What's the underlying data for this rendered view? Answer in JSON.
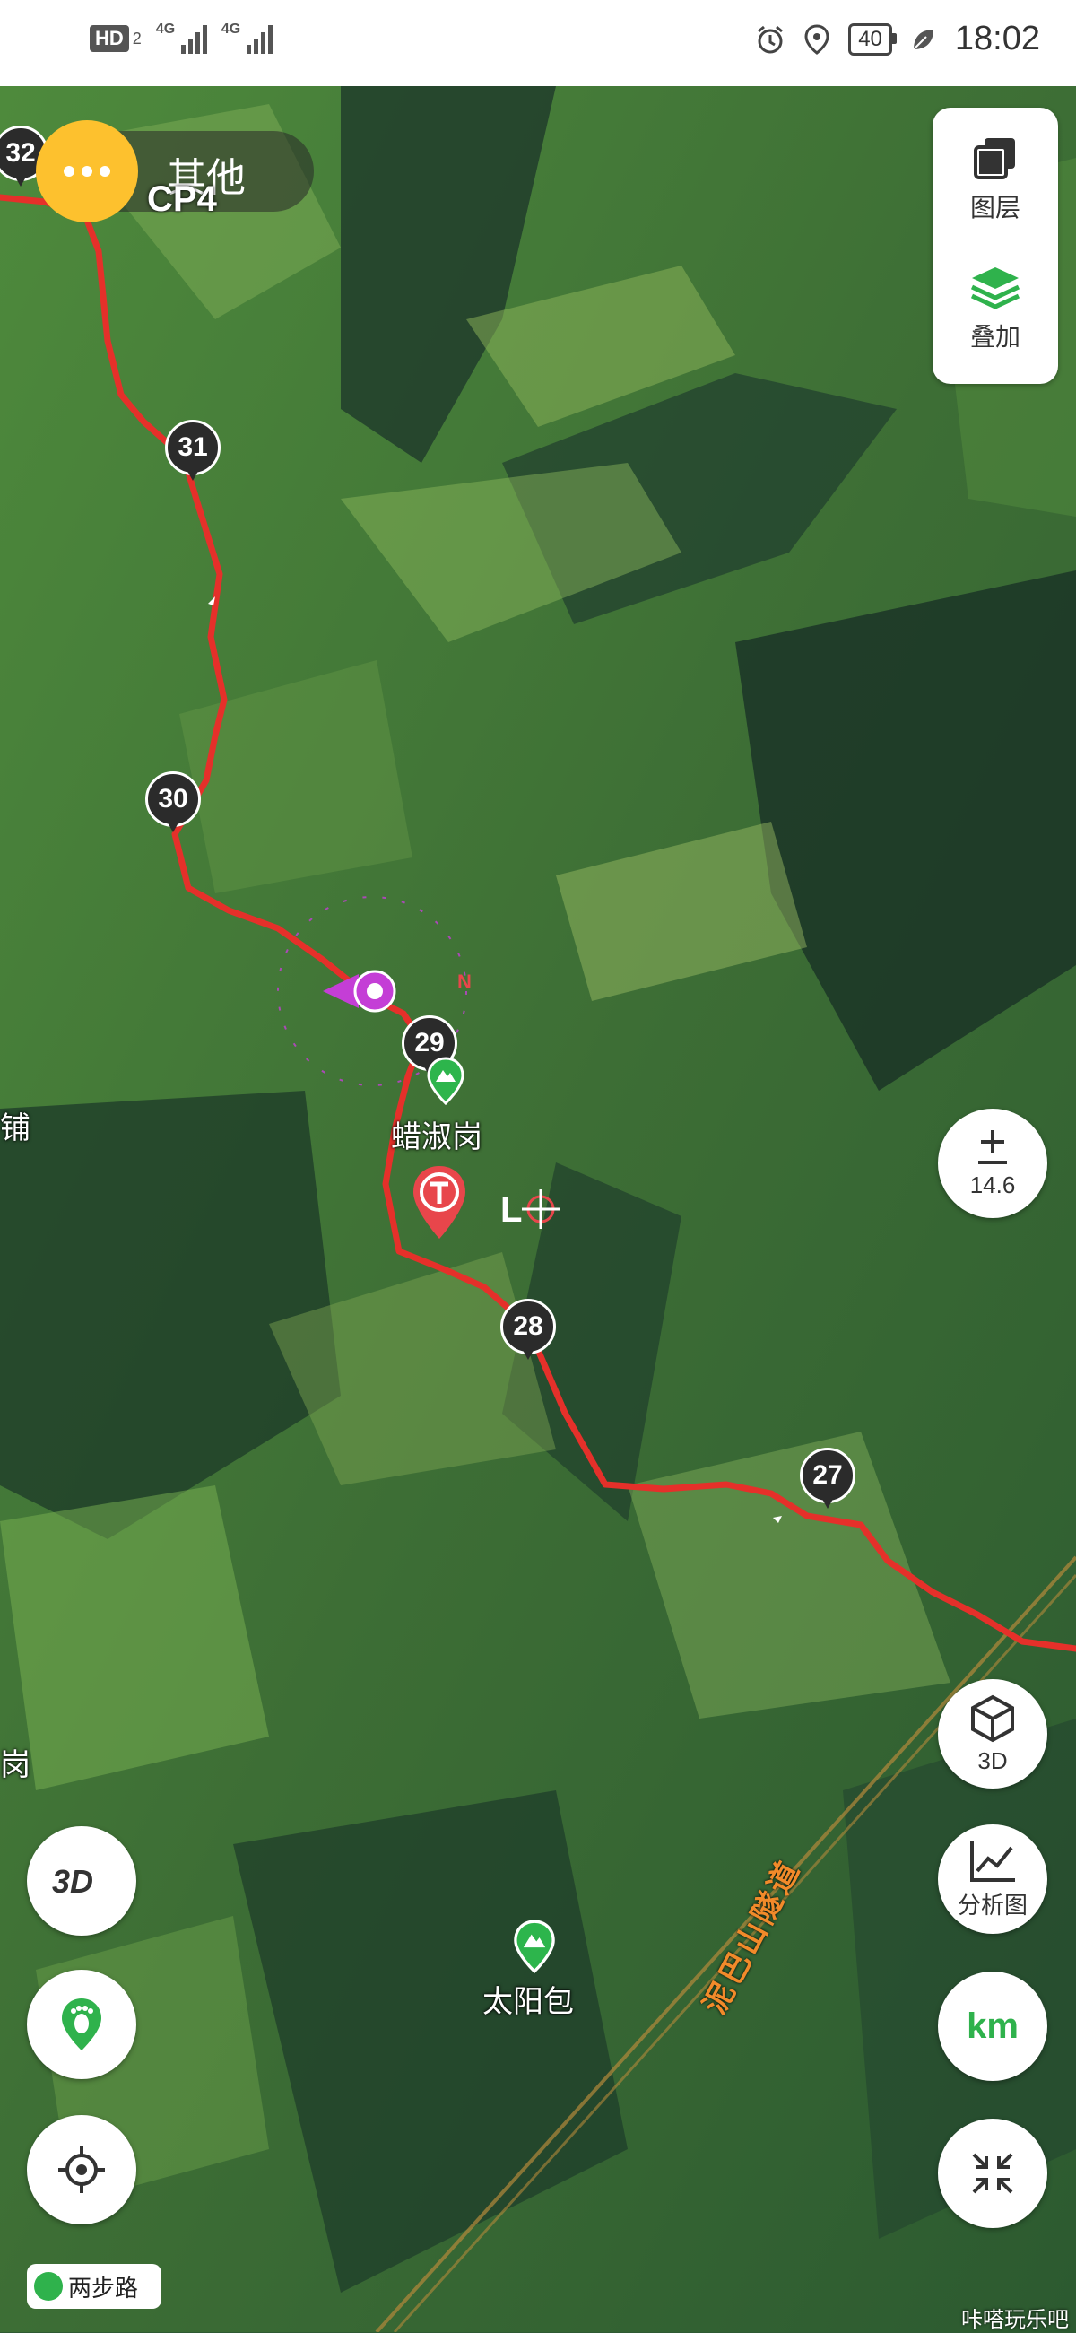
{
  "status_bar": {
    "hd": "HD",
    "hd_sub": "2",
    "signal1_label": "4G",
    "signal2_label": "4G",
    "battery": "40",
    "time": "18:02"
  },
  "map": {
    "other_button_label": "其他",
    "checkpoint_label": "CP4",
    "layers_label": "图层",
    "overlay_label": "叠加",
    "zoom_level": "14.6",
    "btn_3d_label": "3D",
    "analysis_label": "分析图",
    "unit_label": "km",
    "km_markers": [
      "32",
      "31",
      "30",
      "29",
      "28",
      "27"
    ],
    "places": {
      "left_edge_1": "铺",
      "peak_name": "蜡淑岗",
      "left_edge_2": "岗",
      "taiyangbao": "太阳包"
    },
    "road_name": "泥巴山隧道",
    "compass_letter": "N",
    "brand": "两步路",
    "watermark": "咔嗒玩乐吧",
    "colors": {
      "track": "#e5302a",
      "accent_yellow": "#fdc12e",
      "brand_green": "#2fb24c",
      "location_purple": "#c43ed6",
      "poi_red": "#e8464b"
    }
  }
}
